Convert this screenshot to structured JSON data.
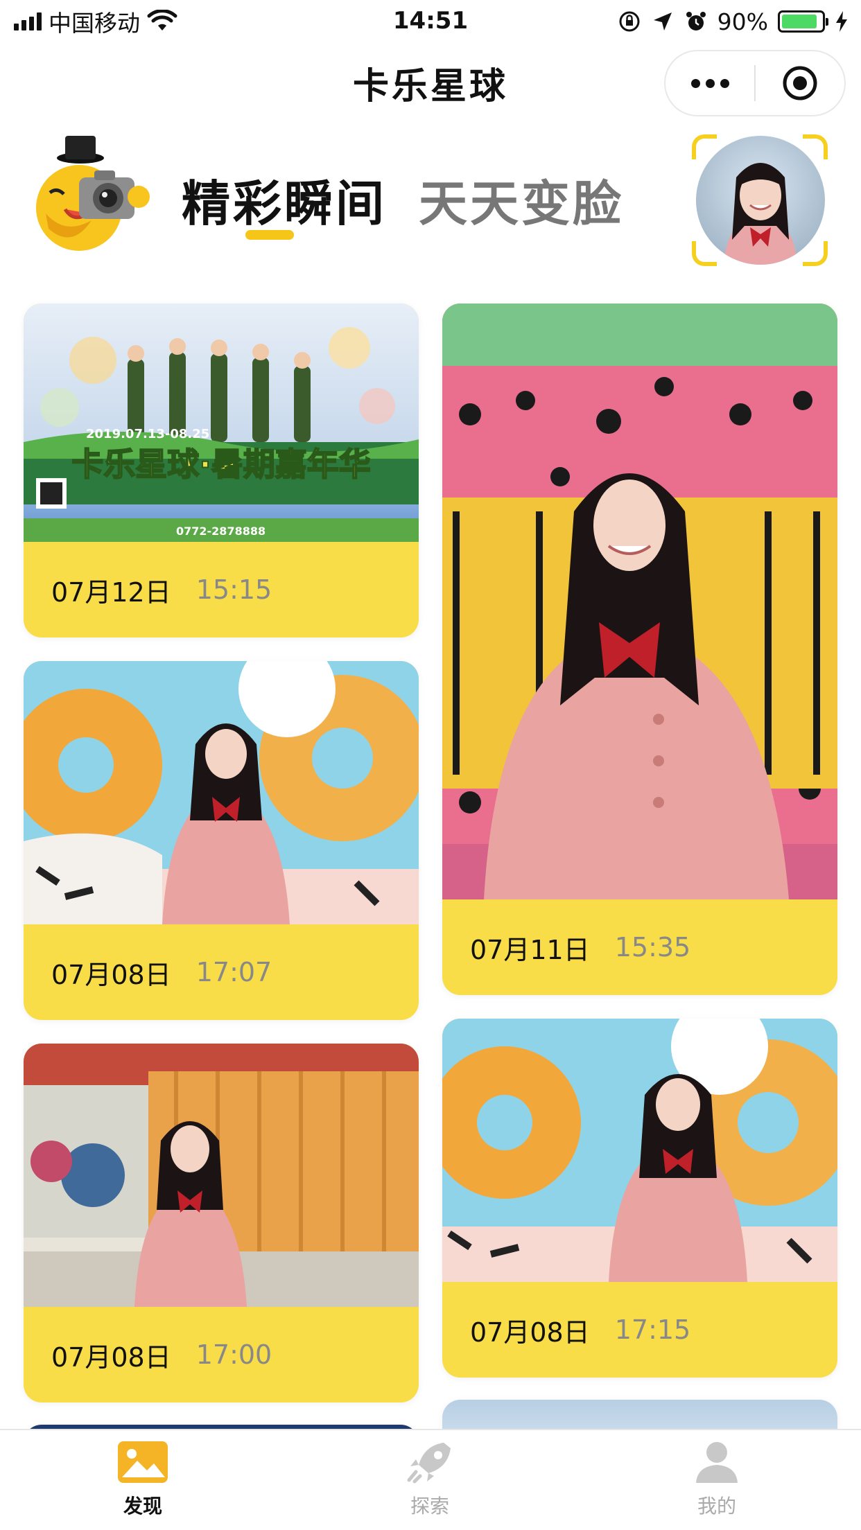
{
  "status_bar": {
    "carrier": "中国移动",
    "time": "14:51",
    "battery_percent": "90%",
    "battery_level": 0.9
  },
  "nav": {
    "title": "卡乐星球"
  },
  "header": {
    "tabs": [
      {
        "label": "精彩瞬间",
        "active": true
      },
      {
        "label": "天天变脸",
        "active": false
      }
    ]
  },
  "colors": {
    "accent_yellow": "#f8dd48",
    "underline_yellow": "#f5c518",
    "battery_green": "#4cd964"
  },
  "feed": {
    "left_column": [
      {
        "date": "07月12日",
        "time": "15:15",
        "photo": "poster",
        "poster_text": "卡乐星球·暑期嘉年华",
        "poster_dates": "2019.07.13-08.25",
        "poster_phone": "0772-2878888"
      },
      {
        "date": "07月08日",
        "time": "17:07",
        "photo": "girl-graffiti"
      },
      {
        "date": "07月08日",
        "time": "17:00",
        "photo": "girl-containers"
      }
    ],
    "right_column": [
      {
        "date": "07月11日",
        "time": "15:35",
        "photo": "girl-pink-container"
      },
      {
        "date": "07月08日",
        "time": "17:15",
        "photo": "girl-graffiti"
      }
    ]
  },
  "tab_bar": {
    "items": [
      {
        "label": "发现",
        "icon": "image-icon",
        "active": true
      },
      {
        "label": "探索",
        "icon": "rocket-icon",
        "active": false
      },
      {
        "label": "我的",
        "icon": "user-icon",
        "active": false
      }
    ]
  }
}
